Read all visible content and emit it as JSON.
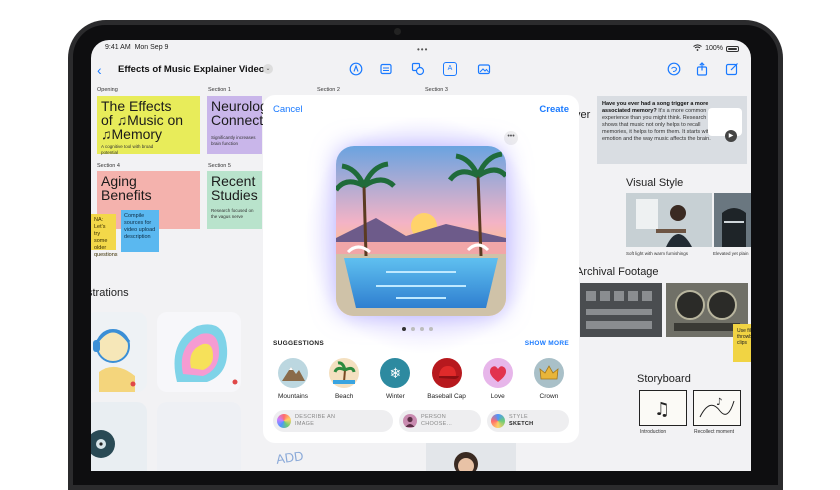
{
  "status_bar": {
    "time": "9:41 AM",
    "date": "Mon Sep 9",
    "battery": "100%"
  },
  "toolbar": {
    "title": "Effects of Music Explainer Video"
  },
  "board": {
    "section_labels": [
      "Opening",
      "Section 1",
      "Section 2",
      "Section 3",
      "Section 4",
      "Section 5"
    ],
    "opening_card": {
      "title_line1": "The Effects",
      "title_line2": "of ♫Music on",
      "title_line3": "♫Memory",
      "subtitle": "A cognitive tool with broad potential"
    },
    "section1_card": {
      "title_line1": "Neurolog",
      "title_line2": "Connect",
      "subtitle": "Significantly increases brain function"
    },
    "section4_card": {
      "title_line1": "Aging",
      "title_line2": "Benefits",
      "subtitle": ""
    },
    "section5_card": {
      "title_line1": "Recent",
      "title_line2": "Studies",
      "subtitle": "Research focused on the vagus nerve"
    },
    "sticky_blue": "Compile sources for video upload description",
    "sticky_yellow": "NA: Let's try some older questions",
    "illustrations_heading": "strations",
    "question_card": {
      "bold_text": "Have you ever had a song trigger a more associated memory?",
      "body": "It's a more common experience than you might think. Research shows that music not only helps to recall memories, it helps to form them. It starts with emotion and the way music affects the brain."
    },
    "partial_heading": "ver",
    "visual_style_heading": "Visual Style",
    "visual_style_caption_1": "Soft light with warm furnishings",
    "visual_style_caption_2": "Elevated yet plain",
    "archival_heading": "Archival Footage",
    "sticky_filters": "Use filters for throwback clips",
    "storyboard_heading": "Storyboard",
    "storyboard_caption_1": "Introduction",
    "storyboard_caption_2": "Recollect moment"
  },
  "modal": {
    "cancel_label": "Cancel",
    "create_label": "Create",
    "more_label": "•••",
    "suggestions_label": "SUGGESTIONS",
    "show_more_label": "SHOW MORE",
    "suggestions": [
      {
        "label": "Mountains",
        "icon": "mountain-icon",
        "color": "#bcd7e0"
      },
      {
        "label": "Beach",
        "icon": "beach-icon",
        "color": "#f4e0c0"
      },
      {
        "label": "Winter",
        "icon": "snowflake-icon",
        "color": "#2d8aa0"
      },
      {
        "label": "Baseball Cap",
        "icon": "cap-icon",
        "color": "#b7191e"
      },
      {
        "label": "Love",
        "icon": "heart-icon",
        "color": "#e7b6ea"
      },
      {
        "label": "Crown",
        "icon": "crown-icon",
        "color": "#a9c0c8"
      }
    ],
    "describe_label_line1": "DESCRIBE AN",
    "describe_label_line2": "IMAGE",
    "person_label_line1": "PERSON",
    "person_label_line2": "CHOOSE...",
    "style_label_line1": "STYLE",
    "style_label_line2": "SKETCH"
  },
  "colors": {
    "accent": "#1a7aff"
  }
}
